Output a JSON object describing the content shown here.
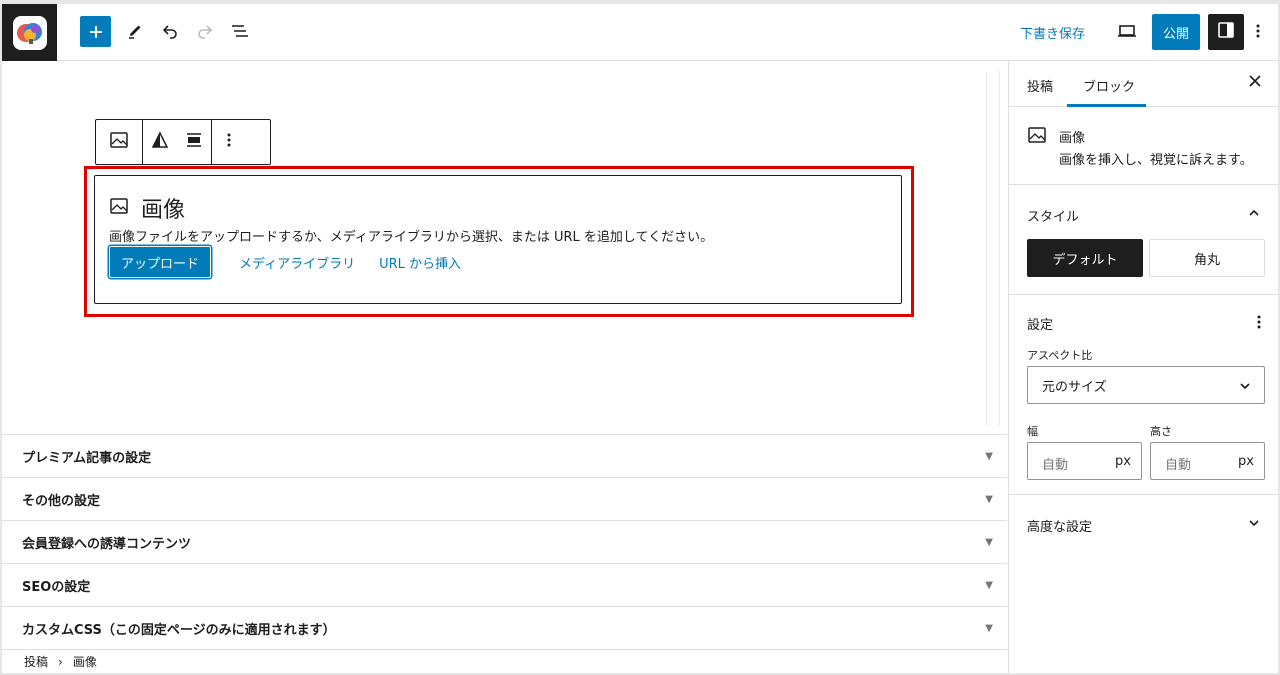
{
  "toolbar": {
    "save_draft": "下書き保存",
    "publish": "公開"
  },
  "block": {
    "title": "画像",
    "instructions": "画像ファイルをアップロードするか、メディアライブラリから選択、または URL を追加してください。",
    "upload_label": "アップロード",
    "media_library_label": "メディアライブラリ",
    "insert_url_label": "URL から挿入"
  },
  "metaboxes": [
    {
      "label": "プレミアム記事の設定"
    },
    {
      "label": "その他の設定"
    },
    {
      "label": "会員登録への誘導コンテンツ"
    },
    {
      "label": "SEOの設定"
    },
    {
      "label": "カスタムCSS（この固定ページのみに適用されます）"
    }
  ],
  "breadcrumb": {
    "root": "投稿",
    "separator": "›",
    "current": "画像"
  },
  "sidebar": {
    "tabs": [
      "投稿",
      "ブロック"
    ],
    "active_tab": "ブロック",
    "block_card": {
      "name": "画像",
      "description": "画像を挿入し、視覚に訴えます。"
    },
    "styles": {
      "heading": "スタイル",
      "options": [
        "デフォルト",
        "角丸"
      ],
      "selected": "デフォルト"
    },
    "settings": {
      "heading": "設定",
      "aspect_label": "アスペクト比",
      "aspect_value": "元のサイズ",
      "width_label": "幅",
      "height_label": "高さ",
      "width_placeholder": "自動",
      "height_placeholder": "自動",
      "unit": "px"
    },
    "advanced": {
      "heading": "高度な設定"
    }
  },
  "colors": {
    "accent": "#007cba",
    "highlight": "#e10000",
    "dark": "#1e1e1e"
  }
}
